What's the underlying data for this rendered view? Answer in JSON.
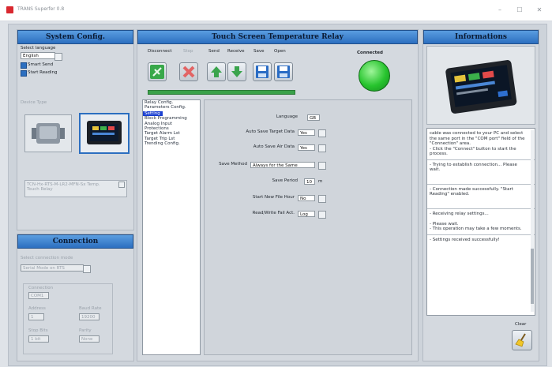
{
  "window": {
    "title": "TRANS Superfer 0.8",
    "min_glyph": "–",
    "max_glyph": "☐",
    "close_glyph": "✕"
  },
  "system_config": {
    "header": "System Config.",
    "language_label": "Select language",
    "language_value": "English",
    "smart_send_label": "Smart Send",
    "start_reading_label": "Start Reading",
    "device_type_label": "Device Type",
    "device_desc": "TCN-Hx-RTS-M-LR2-MFN-Sx Temp. Touch Relay"
  },
  "connection": {
    "header": "Connection",
    "port_label": "Select connection mode",
    "port_value": "Serial Mode on RTS",
    "group_label": "Connection",
    "com_value": "COM1",
    "address_label": "Address",
    "address_value": "1",
    "baud_label": "Baud Rate",
    "baud_value": "19200",
    "stop_label": "Stop Bits",
    "stop_value": "1 bit",
    "parity_label": "Parity",
    "parity_value": "None"
  },
  "relay": {
    "header": "Touch Screen Temperature Relay",
    "toolbar": {
      "disconnect": "Disconnect",
      "stop": "Stop",
      "send": "Send",
      "receive": "Receive",
      "save": "Save",
      "open": "Open"
    },
    "status_label": "Connected",
    "menu": [
      "Relay Config.",
      "Parameters Config.",
      "Setting",
      "Block Programming",
      "Analog Input",
      "Protections",
      "Target Alarm Lst",
      "Target Trip Lst",
      "Trending Config."
    ],
    "fields": [
      {
        "label": "Language",
        "value": "GB"
      },
      {
        "label": "Auto Save Target Data",
        "value": "Yes"
      },
      {
        "label": "Auto Save Air Data",
        "value": "Yes"
      },
      {
        "label": "Save Method",
        "value": "Always for the Same"
      },
      {
        "label": "Save Period",
        "value": "10",
        "unit": "m"
      },
      {
        "label": "Start New File Hour",
        "value": "No"
      },
      {
        "label": "Read/Write Fail Act.",
        "value": "Log"
      }
    ]
  },
  "info": {
    "header": "Informations",
    "messages": [
      "cable was connected to your PC and select the same port in the \"COM port\" field of the \"Connection\" area.\n- Click the \"Connect\" button to start the process.",
      "- Trying to establish connection... Please wait.",
      "- Connection made successfully. \"Start Reading\" enabled.",
      "- Receiving relay settings...\n\n- Please wait.\n- This operation may take a few moments.",
      "- Settings received successfully!"
    ],
    "clear_label": "Clear"
  }
}
